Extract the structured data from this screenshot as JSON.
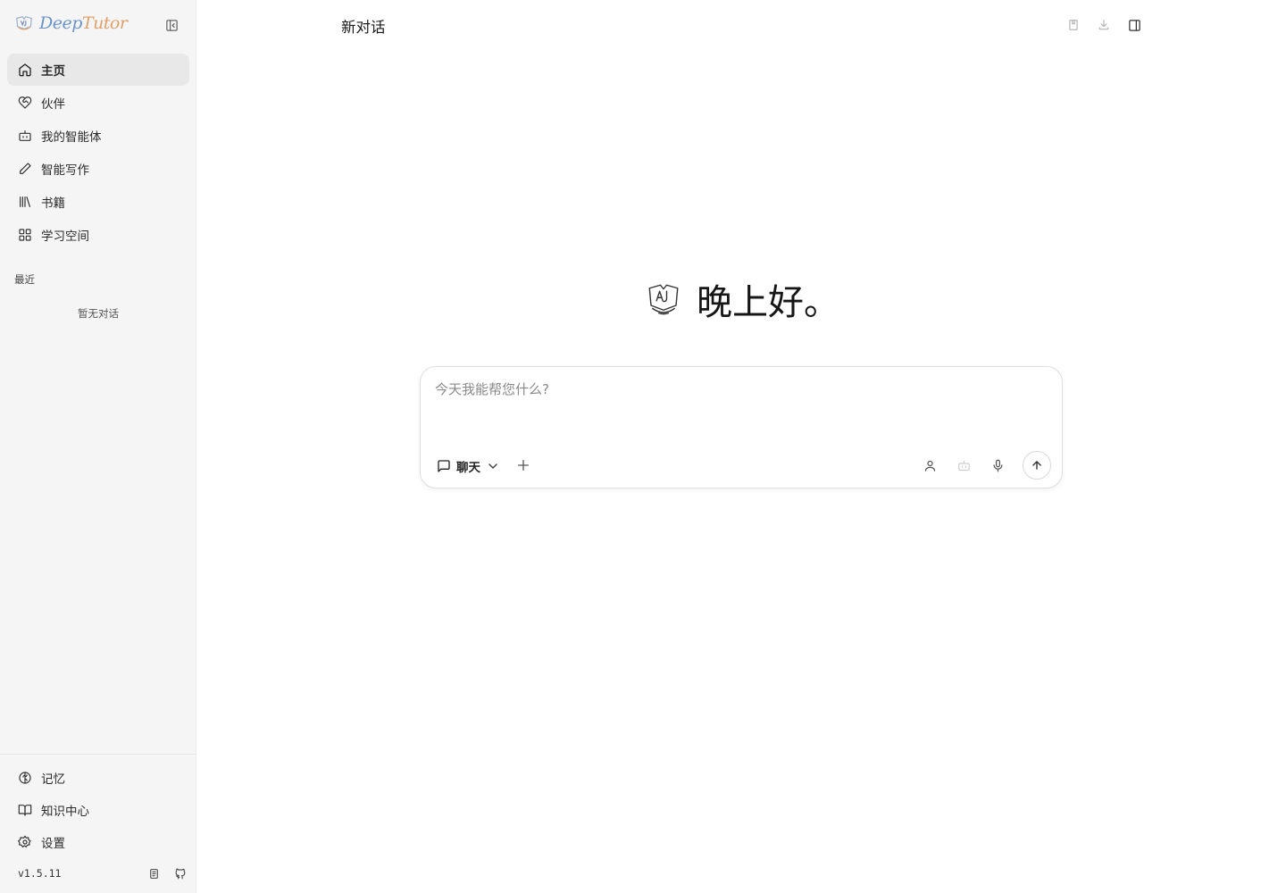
{
  "brand": {
    "name_part1": "Deep",
    "name_part2": "Tutor",
    "logo_icon": "deeptutor-logo-icon"
  },
  "sidebar": {
    "collapse_icon": "sidebar-collapse-icon",
    "items": [
      {
        "label": "主页",
        "icon": "home-icon",
        "active": true
      },
      {
        "label": "伙伴",
        "icon": "heart-handshake-icon",
        "active": false
      },
      {
        "label": "我的智能体",
        "icon": "bot-icon",
        "active": false
      },
      {
        "label": "智能写作",
        "icon": "pencil-icon",
        "active": false
      },
      {
        "label": "书籍",
        "icon": "library-icon",
        "active": false
      },
      {
        "label": "学习空间",
        "icon": "grid-icon",
        "active": false
      }
    ],
    "recent_title": "最近",
    "recent_empty": "暂无对话",
    "bottom_items": [
      {
        "label": "记忆",
        "icon": "brain-icon"
      },
      {
        "label": "知识中心",
        "icon": "book-open-icon"
      },
      {
        "label": "设置",
        "icon": "settings-icon"
      }
    ],
    "version": "v1.5.11",
    "footer_icons": [
      "docs-icon",
      "github-icon"
    ]
  },
  "topbar": {
    "title": "新对话",
    "actions": [
      "bookmark-icon",
      "download-icon",
      "panel-right-icon"
    ]
  },
  "main": {
    "greeting": "晚上好。",
    "composer": {
      "placeholder": "今天我能帮您什么?",
      "value": "",
      "mode_label": "聊天",
      "mode_icon": "message-square-icon",
      "tools": [
        "user-icon",
        "bot-icon",
        "mic-icon"
      ],
      "send_icon": "arrow-up-icon"
    }
  },
  "colors": {
    "sidebar_bg": "#f5f5f5",
    "active_item_bg": "#e8e8e8",
    "brand_deep": "#6a93c9",
    "brand_tutor": "#e0a06a"
  }
}
